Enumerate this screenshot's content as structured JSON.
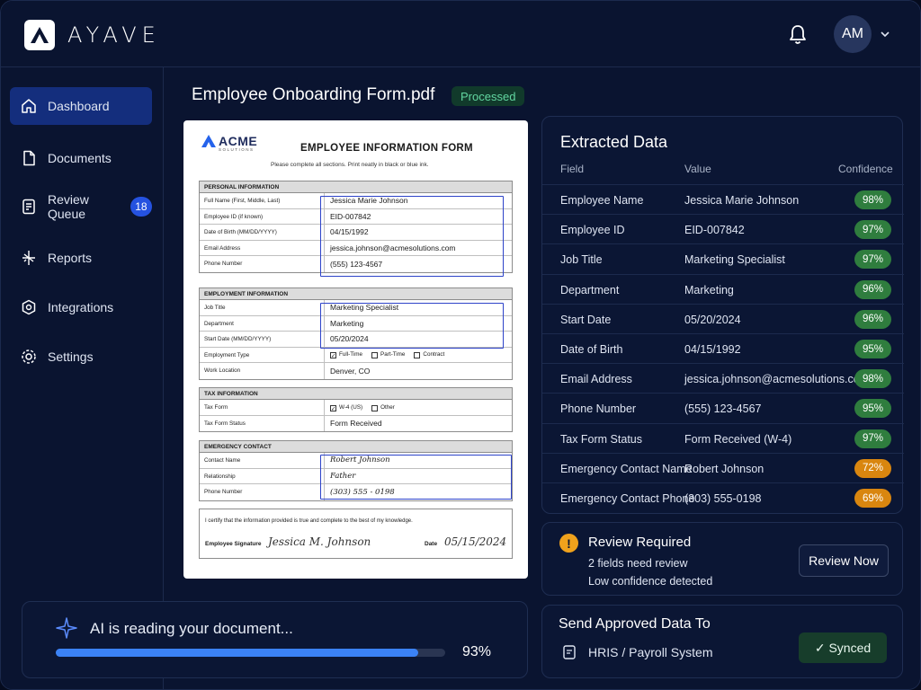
{
  "app": {
    "brand": "AYAVE",
    "user_initials": "AM"
  },
  "sidebar": {
    "items": [
      {
        "label": "Dashboard",
        "icon": "home-icon",
        "active": true
      },
      {
        "label": "Documents",
        "icon": "document-icon"
      },
      {
        "label": "Review Queue",
        "icon": "checklist-icon",
        "badge": "18"
      },
      {
        "label": "Reports",
        "icon": "chart-icon"
      },
      {
        "label": "Integrations",
        "icon": "integration-icon"
      },
      {
        "label": "Settings",
        "icon": "gear-icon"
      }
    ]
  },
  "document": {
    "filename": "Employee Onboarding Form.pdf",
    "status": "Processed"
  },
  "form": {
    "company": "ACME",
    "company_sub": "SOLUTIONS",
    "title": "EMPLOYEE INFORMATION FORM",
    "subtitle": "Please complete all sections. Print neatly in black or blue ink.",
    "personal": {
      "heading": "PERSONAL INFORMATION",
      "rows": [
        {
          "label": "Full Name (First, Middle, Last)",
          "value": "Jessica  Marie  Johnson"
        },
        {
          "label": "Employee ID (if known)",
          "value": "EID-007842"
        },
        {
          "label": "Date of Birth (MM/DD/YYYY)",
          "value": "04/15/1992"
        },
        {
          "label": "Email Address",
          "value": "jessica.johnson@acmesolutions.com"
        },
        {
          "label": "Phone Number",
          "value": "(555) 123-4567"
        }
      ]
    },
    "employment": {
      "heading": "EMPLOYMENT INFORMATION",
      "job_title_label": "Job Title",
      "job_title": "Marketing  Specialist",
      "department_label": "Department",
      "department": "Marketing",
      "start_label": "Start Date (MM/DD/YYYY)",
      "start": "05/20/2024",
      "type_label": "Employment Type",
      "type_options": [
        "Full-Time",
        "Part-Time",
        "Contract"
      ],
      "location_label": "Work Location",
      "location": "Denver, CO"
    },
    "tax": {
      "heading": "TAX INFORMATION",
      "form_label": "Tax Form",
      "form_options": [
        "W-4 (US)",
        "Other"
      ],
      "status_label": "Tax Form Status",
      "status": "Form Received"
    },
    "emergency": {
      "heading": "EMERGENCY CONTACT",
      "rows": [
        {
          "label": "Contact Name",
          "value": "Robert  Johnson"
        },
        {
          "label": "Relationship",
          "value": "Father"
        },
        {
          "label": "Phone Number",
          "value": "(303) 555 - 0198"
        }
      ]
    },
    "certify": "I certify that the information provided is true and complete to the best of my knowledge.",
    "signature_label": "Employee Signature",
    "signature": "Jessica  M.  Johnson",
    "date_label": "Date",
    "date": "05/15/2024"
  },
  "progress": {
    "text": "AI is reading your document...",
    "percent": 93,
    "percent_label": "93%"
  },
  "extracted": {
    "title": "Extracted Data",
    "columns": [
      "Field",
      "Value",
      "Confidence"
    ],
    "rows": [
      {
        "field": "Employee Name",
        "value": "Jessica Marie Johnson",
        "confidence": "98%",
        "level": "high"
      },
      {
        "field": "Employee ID",
        "value": "EID-007842",
        "confidence": "97%",
        "level": "high"
      },
      {
        "field": "Job Title",
        "value": "Marketing Specialist",
        "confidence": "97%",
        "level": "high"
      },
      {
        "field": "Department",
        "value": "Marketing",
        "confidence": "96%",
        "level": "high"
      },
      {
        "field": "Start Date",
        "value": "05/20/2024",
        "confidence": "96%",
        "level": "high"
      },
      {
        "field": "Date of Birth",
        "value": "04/15/1992",
        "confidence": "95%",
        "level": "high"
      },
      {
        "field": "Email Address",
        "value": "jessica.johnson@acmesolutions.com",
        "confidence": "98%",
        "level": "high"
      },
      {
        "field": "Phone Number",
        "value": "(555) 123-4567",
        "confidence": "95%",
        "level": "high"
      },
      {
        "field": "Tax Form Status",
        "value": "Form Received (W-4)",
        "confidence": "97%",
        "level": "high"
      },
      {
        "field": "Emergency Contact Name",
        "value": "Robert Johnson",
        "confidence": "72%",
        "level": "low"
      },
      {
        "field": "Emergency Contact Phone",
        "value": "(303) 555-0198",
        "confidence": "69%",
        "level": "low"
      }
    ]
  },
  "review": {
    "title": "Review Required",
    "line1": "2 fields need review",
    "line2": "Low confidence detected",
    "button": "Review Now"
  },
  "send": {
    "title": "Send Approved Data To",
    "system": "HRIS / Payroll System",
    "button": "✓  Synced"
  },
  "colors": {
    "high": "#2f7d3e",
    "low": "#d9860f",
    "accent": "#3b82f6",
    "active_nav": "#142e7d"
  }
}
